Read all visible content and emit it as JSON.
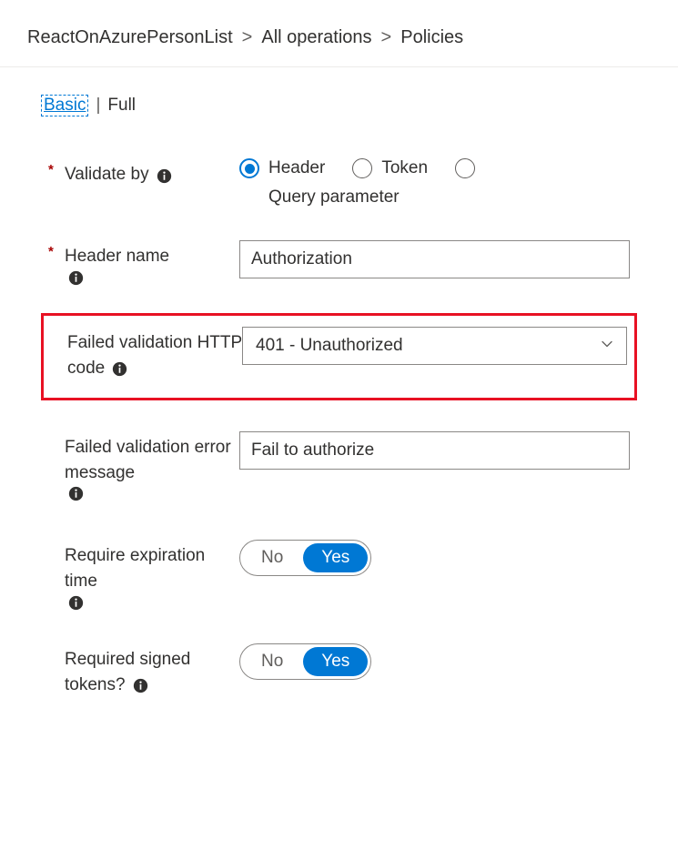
{
  "breadcrumb": {
    "items": [
      "ReactOnAzurePersonList",
      "All operations",
      "Policies"
    ],
    "separator": ">"
  },
  "viewToggle": {
    "basic": "Basic",
    "pipe": "|",
    "full": "Full"
  },
  "fields": {
    "validateBy": {
      "label": "Validate by",
      "options": [
        "Header",
        "Token",
        "Query parameter"
      ],
      "selected": "Header"
    },
    "headerName": {
      "label": "Header name",
      "value": "Authorization"
    },
    "failedCode": {
      "label": "Failed validation HTTP code",
      "value": "401 - Unauthorized"
    },
    "failedMsg": {
      "label": "Failed validation error message",
      "value": "Fail to authorize"
    },
    "requireExp": {
      "label": "Require expiration time",
      "no": "No",
      "yes": "Yes"
    },
    "requiredSigned": {
      "label": "Required signed tokens?",
      "no": "No",
      "yes": "Yes"
    }
  }
}
